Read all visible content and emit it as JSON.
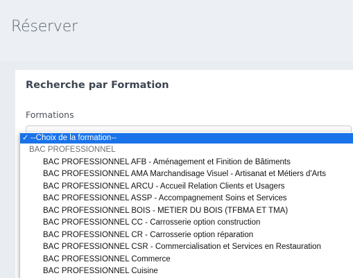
{
  "page": {
    "title": "Réserver"
  },
  "search": {
    "title": "Recherche par Formation",
    "field_label": "Formations"
  },
  "dropdown": {
    "selected_option": "--Choix de la formation--",
    "check_mark": "✓",
    "group_label": "BAC PROFESSIONNEL",
    "options": [
      "BAC PROFESSIONNEL AFB - Aménagement et Finition de Bâtiments",
      "BAC PROFESSIONNEL AMA Marchandisage Visuel - Artisanat et Métiers d'Arts",
      "BAC PROFESSIONNEL ARCU - Accueil Relation Clients et Usagers",
      "BAC PROFESSIONNEL ASSP - Accompagnement Soins et Services",
      "BAC PROFESSIONNEL BOIS - METIER DU BOIS (TFBMA ET TMA)",
      "BAC PROFESSIONNEL CC - Carrosserie option construction",
      "BAC PROFESSIONNEL CR - Carrosserie option réparation",
      "BAC PROFESSIONNEL CSR - Commercialisation et Services en Restauration",
      "BAC PROFESSIONNEL Commerce",
      "BAC PROFESSIONNEL Cuisine"
    ]
  },
  "colors": {
    "selection": "#1a73e8",
    "page_background": "#e9ecf1"
  }
}
